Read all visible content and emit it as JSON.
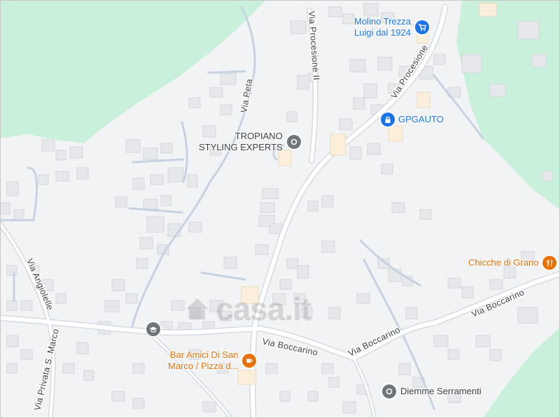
{
  "map": {
    "colors": {
      "background": "#f1f3f4",
      "green_area": "#c8f0da",
      "road": "#ffffff",
      "road_edge": "#d5dbe3",
      "minor_road": "#c6d2e2",
      "building": "#e6e8ec",
      "building_edge": "#d2d6dc",
      "highlight_building": "#fbeedb",
      "label_text": "#3c4043",
      "poi_blue": "#1a73e8",
      "poi_orange": "#e8710a",
      "poi_gray": "#70757a"
    },
    "roads": {
      "via_procesione_ii": "Via Procesione II",
      "via_procesione": "Via Procesione",
      "via_peta": "Via Peta",
      "via_angiolelle": "Via Angiolelle",
      "via_privata_s_marco": "Via Privata S. Marco",
      "via_boccarino_1": "Via Boccarino",
      "via_boccarino_2": "Via Boccarino",
      "via_boccarino_3": "Via Boccarino"
    },
    "pois": {
      "molino": {
        "line1": "Molino Trezza",
        "line2": "Luigi dal 1924",
        "icon": "shopping-cart-icon"
      },
      "gpgauto": {
        "name": "GPGAUTO",
        "icon": "lock-icon"
      },
      "tropiano": {
        "line1": "TROPIANO",
        "line2": "STYLING EXPERTS",
        "icon": "place-icon"
      },
      "chicche": {
        "name": "Chicche di Grano",
        "icon": "cafe-icon"
      },
      "bar": {
        "line1": "Bar Amici Di San",
        "line2": "Marco / Pizza d...",
        "icon": "cafe-icon"
      },
      "diemme": {
        "name": "Diemme Serramenti",
        "icon": "place-icon"
      },
      "school": {
        "icon": "school-icon"
      }
    },
    "watermark": {
      "text": "casa.it",
      "icon": "house-icon"
    }
  }
}
